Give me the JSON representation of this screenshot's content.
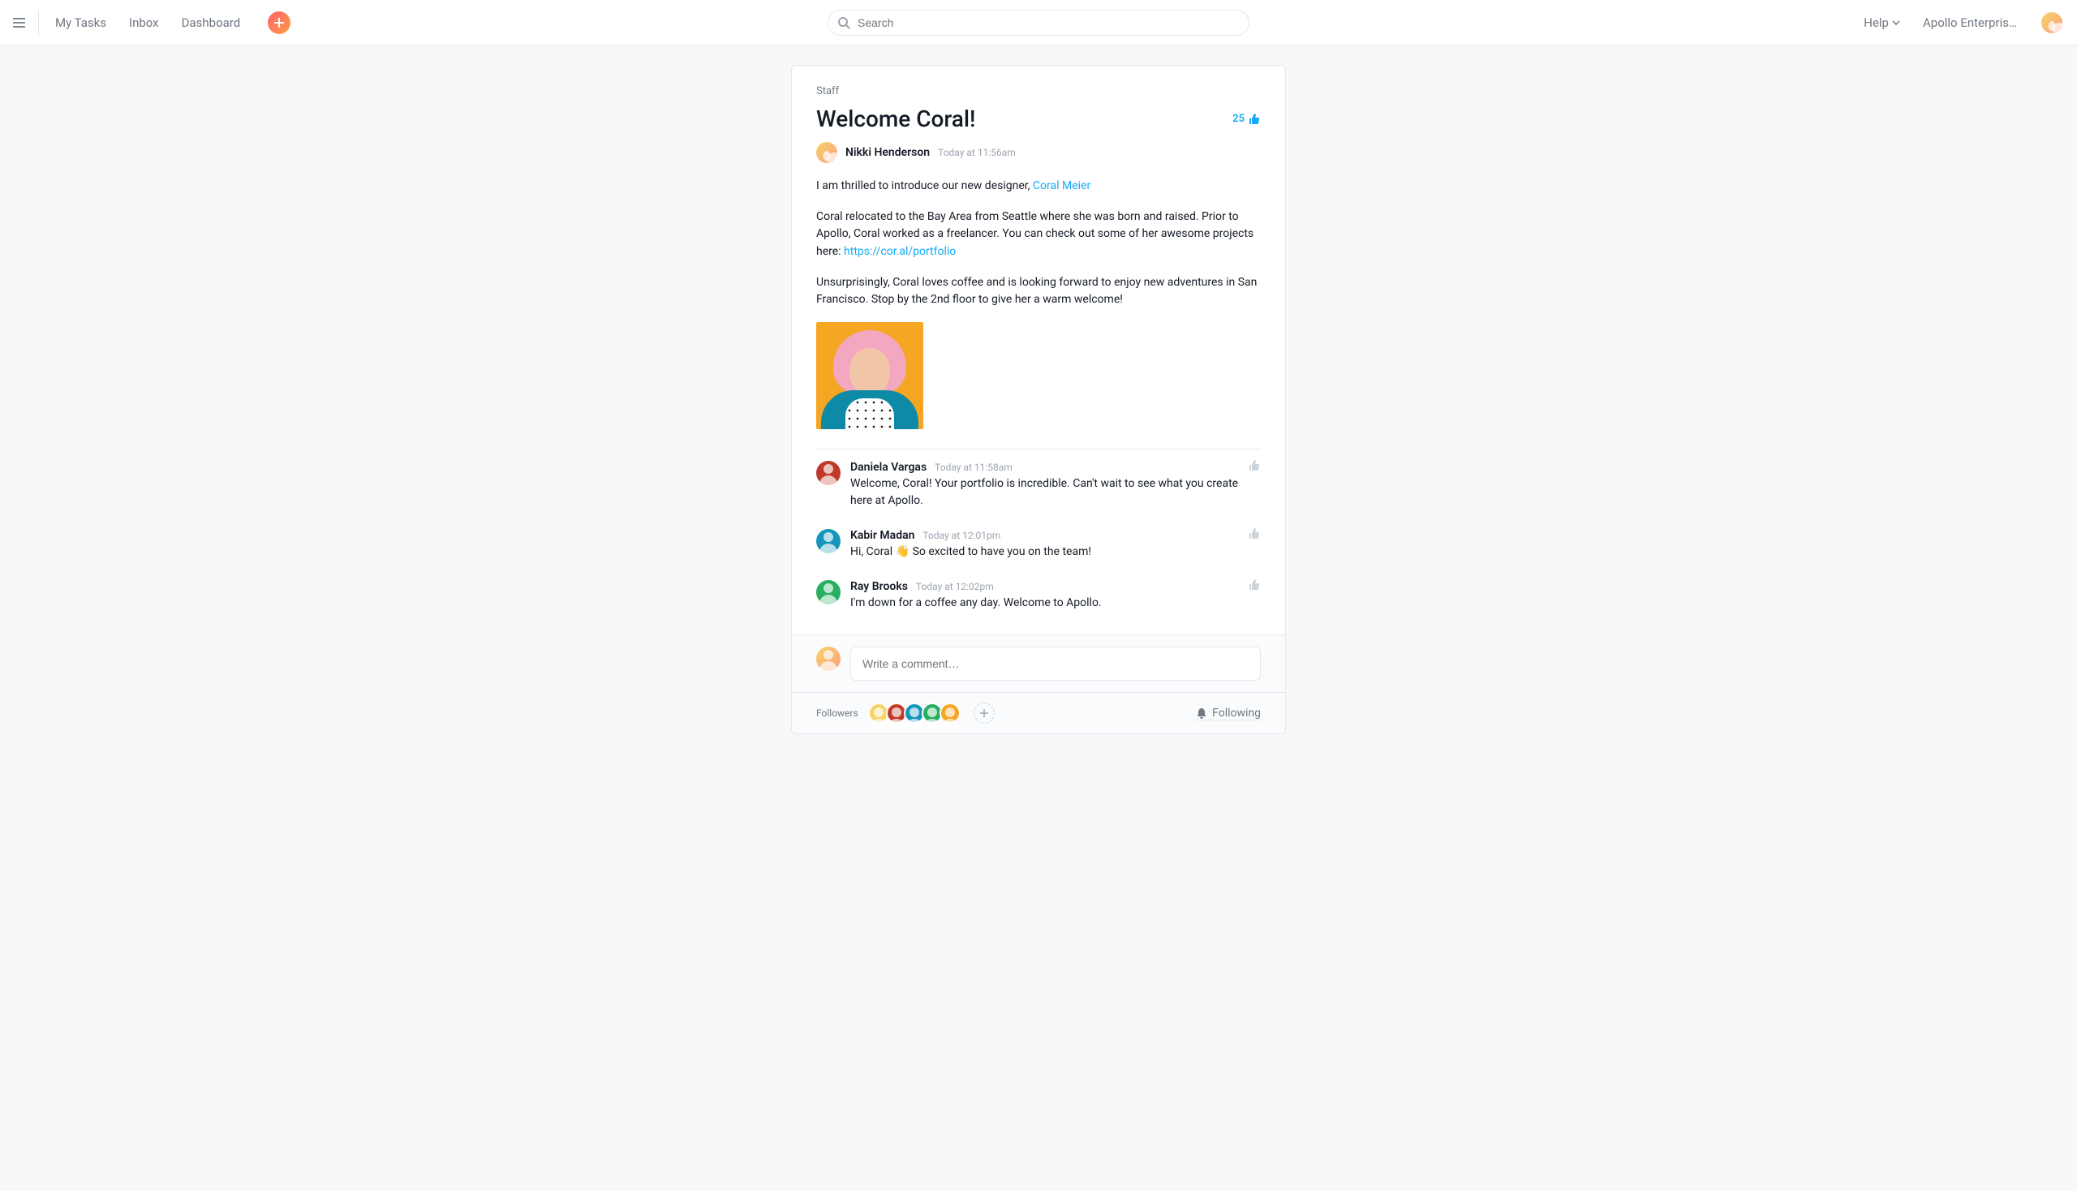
{
  "nav": {
    "my_tasks": "My Tasks",
    "inbox": "Inbox",
    "dashboard": "Dashboard"
  },
  "search": {
    "placeholder": "Search"
  },
  "top_right": {
    "help": "Help",
    "org": "Apollo Enterpris…"
  },
  "post": {
    "context": "Staff",
    "title": "Welcome Coral!",
    "likes": "25",
    "author": "Nikki Henderson",
    "timestamp": "Today at 11:56am",
    "para1_prefix": "I am thrilled to introduce our new designer, ",
    "para1_link": "Coral Meier",
    "para2_prefix": "Coral relocated to the Bay Area from Seattle where she was born and raised. Prior to Apollo, Coral worked as a freelancer. You can check out some of her awesome projects here: ",
    "para2_link": "https://cor.al/portfolio",
    "para3": "Unsurprisingly, Coral loves coffee and is looking forward to enjoy new adventures in San Francisco. Stop by the 2nd floor to give her a warm welcome!"
  },
  "comments": [
    {
      "name": "Daniela Vargas",
      "time": "Today at 11:58am",
      "text": "Welcome, Coral! Your portfolio is incredible. Can't wait to see what you create here at Apollo.",
      "avatar_bg": "#c0392b"
    },
    {
      "name": "Kabir Madan",
      "time": "Today at 12:01pm",
      "text": "Hi, Coral 👋 So excited to have you on the team!",
      "avatar_bg": "#1496bb"
    },
    {
      "name": "Ray Brooks",
      "time": "Today at 12:02pm",
      "text": "I'm down for a coffee any day. Welcome to Apollo.",
      "avatar_bg": "#27ae60"
    }
  ],
  "compose": {
    "placeholder": "Write a comment…"
  },
  "footer": {
    "label": "Followers",
    "following": "Following",
    "avatar_colors": [
      "#f6d365",
      "#c0392b",
      "#1496bb",
      "#27ae60",
      "#f5a623"
    ]
  }
}
